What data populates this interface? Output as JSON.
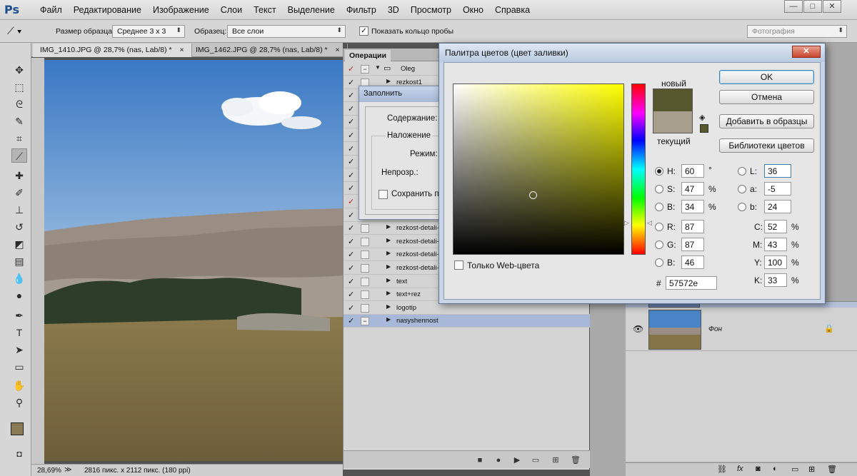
{
  "app": {
    "logo": "Ps"
  },
  "menu": [
    "Файл",
    "Редактирование",
    "Изображение",
    "Слои",
    "Текст",
    "Выделение",
    "Фильтр",
    "3D",
    "Просмотр",
    "Окно",
    "Справка"
  ],
  "window_controls": {
    "minimize": "—",
    "restore": "□",
    "close": "✕"
  },
  "options": {
    "sample_size_label": "Размер образца:",
    "sample_size_value": "Среднее 3 x 3",
    "sample_label": "Образец:",
    "sample_value": "Все слои",
    "show_ring_label": "Показать кольцо пробы",
    "workspace": "Фотография"
  },
  "doc_tabs": [
    {
      "label": "IMG_1410.JPG @ 28,7% (nas, Lab/8) *",
      "close": "×"
    },
    {
      "label": "IMG_1462.JPG @ 28,7% (nas, Lab/8) *",
      "close": "×"
    }
  ],
  "status": {
    "zoom": "28,69%",
    "info": "2816 пикс. x 2112 пикс. (180 ppi)"
  },
  "actions_panel": {
    "tab": "Операции",
    "rows": [
      {
        "check": "✓",
        "name": "Oleg",
        "folder": true,
        "red": true
      },
      {
        "check": "✓",
        "name": "rezkost1"
      },
      {
        "check": "✓",
        "name": ""
      },
      {
        "check": "✓",
        "name": ""
      },
      {
        "check": "✓",
        "name": ""
      },
      {
        "check": "✓",
        "name": ""
      },
      {
        "check": "✓",
        "name": ""
      },
      {
        "check": "✓",
        "name": ""
      },
      {
        "check": "✓",
        "name": ""
      },
      {
        "check": "✓",
        "name": ""
      },
      {
        "check": "✓",
        "name": "",
        "red": true
      },
      {
        "check": "✓",
        "name": ""
      },
      {
        "check": "✓",
        "name": "rezkost-detali-"
      },
      {
        "check": "✓",
        "name": "rezkost-detali-"
      },
      {
        "check": "✓",
        "name": "rezkost-detali-"
      },
      {
        "check": "✓",
        "name": "rezkost-detali-"
      },
      {
        "check": "✓",
        "name": "text"
      },
      {
        "check": "✓",
        "name": "text+rez"
      },
      {
        "check": "✓",
        "name": "logotip"
      },
      {
        "check": "✓",
        "name": "nasyshennost",
        "selected": true
      }
    ]
  },
  "fill_dialog": {
    "title": "Заполнить",
    "content_label": "Содержание:",
    "blend_group": "Наложение",
    "mode_label": "Режим:",
    "opacity_label": "Непрозр.:",
    "preserve_label": "Сохранить пр"
  },
  "color_picker": {
    "title": "Палитра цветов (цвет заливки)",
    "new_label": "новый",
    "current_label": "текущий",
    "new_color": "#57572e",
    "current_color": "#a89e8c",
    "only_web": "Только Web-цвета",
    "buttons": {
      "ok": "OK",
      "cancel": "Отмена",
      "add": "Добавить в образцы",
      "libraries": "Библиотеки цветов"
    },
    "hsb": {
      "h": "60",
      "s": "47",
      "b": "34"
    },
    "rgb": {
      "r": "87",
      "g": "87",
      "b": "46"
    },
    "lab": {
      "l": "36",
      "a": "-5",
      "b": "24"
    },
    "cmyk": {
      "c": "52",
      "m": "43",
      "y": "100",
      "k": "33"
    },
    "hex": "57572e",
    "labels": {
      "h": "H:",
      "s": "S:",
      "bb": "B:",
      "r": "R:",
      "g": "G:",
      "b": "B:",
      "l": "L:",
      "a": "a:",
      "lb": "b:",
      "c": "C:",
      "m": "M:",
      "y": "Y:",
      "k": "K:",
      "hash": "#"
    },
    "units": {
      "deg": "°",
      "pct": "%"
    }
  },
  "layers": {
    "layer_name": "Фон"
  },
  "colors": {
    "foreground": "#8a7a55",
    "background": "#ffffff"
  }
}
